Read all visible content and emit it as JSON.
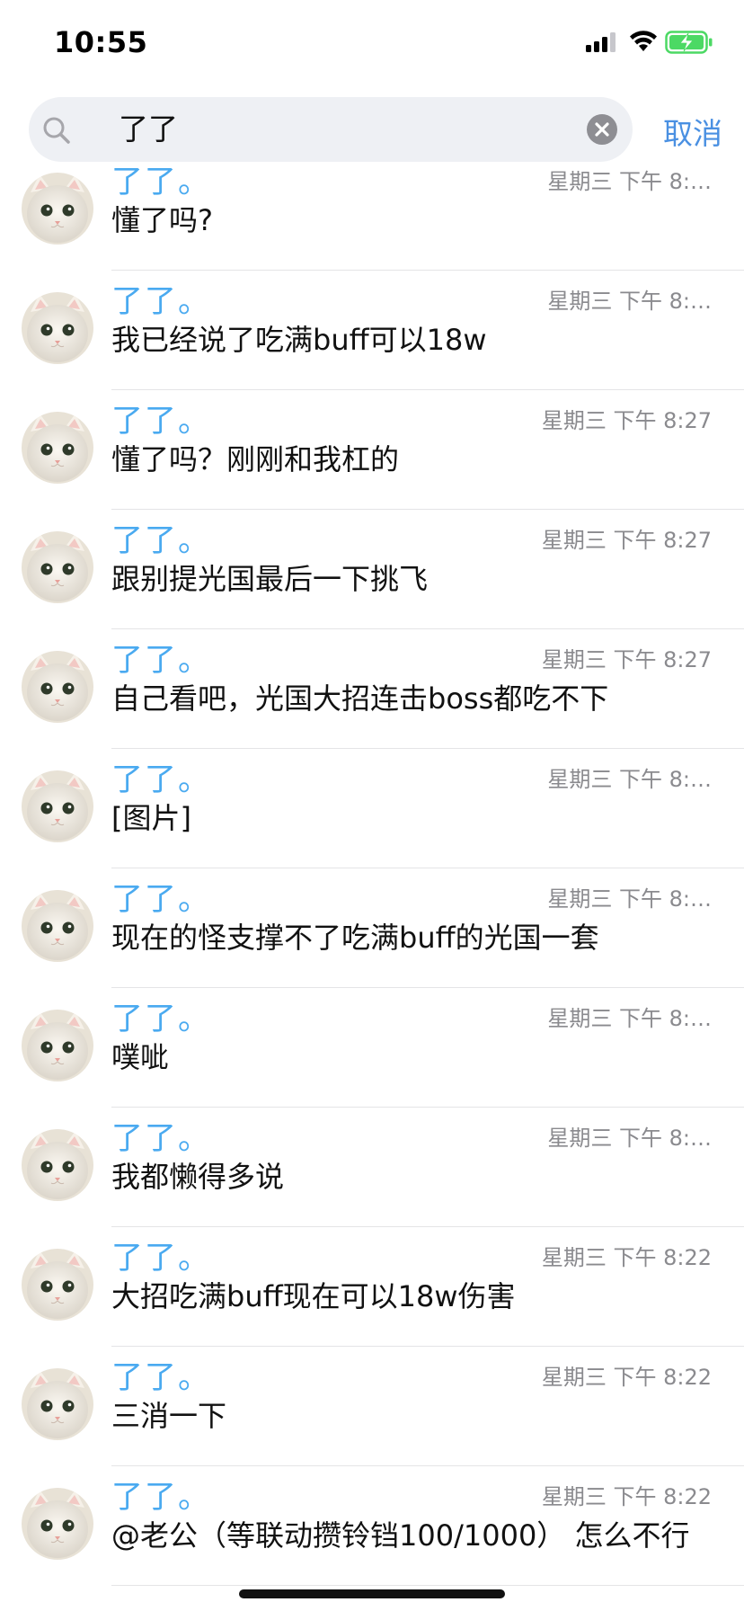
{
  "status_bar": {
    "time": "10:55",
    "signal_icon": "cellular-signal-icon",
    "wifi_icon": "wifi-icon",
    "battery_icon": "battery-charging-icon",
    "battery_color": "#4cd964"
  },
  "search": {
    "icon": "search-icon",
    "value": "了了",
    "clear_icon": "clear-icon",
    "cancel_label": "取消"
  },
  "colors": {
    "accent": "#4a90e2",
    "sender_name": "#4aaaf0",
    "time_text": "#8a8a8e"
  },
  "results": [
    {
      "sender": "了了。",
      "time": "星期三 下午 8:…",
      "message": "懂了吗?"
    },
    {
      "sender": "了了。",
      "time": "星期三 下午 8:…",
      "message": "我已经说了吃满buff可以18w"
    },
    {
      "sender": "了了。",
      "time": "星期三 下午 8:27",
      "message": "懂了吗？刚刚和我杠的"
    },
    {
      "sender": "了了。",
      "time": "星期三 下午 8:27",
      "message": "跟别提光国最后一下挑飞"
    },
    {
      "sender": "了了。",
      "time": "星期三 下午 8:27",
      "message": "自己看吧，光国大招连击boss都吃不下"
    },
    {
      "sender": "了了。",
      "time": "星期三 下午 8:…",
      "message": "[图片]"
    },
    {
      "sender": "了了。",
      "time": "星期三 下午 8:…",
      "message": "现在的怪支撑不了吃满buff的光国一套"
    },
    {
      "sender": "了了。",
      "time": "星期三 下午 8:…",
      "message": "噗呲"
    },
    {
      "sender": "了了。",
      "time": "星期三 下午 8:…",
      "message": "我都懒得多说"
    },
    {
      "sender": "了了。",
      "time": "星期三 下午 8:22",
      "message": "大招吃满buff现在可以18w伤害"
    },
    {
      "sender": "了了。",
      "time": "星期三 下午 8:22",
      "message": "三消一下"
    },
    {
      "sender": "了了。",
      "time": "星期三 下午 8:22",
      "message": "@老公（等联动攒铃铛100/1000） 怎么不行"
    }
  ]
}
